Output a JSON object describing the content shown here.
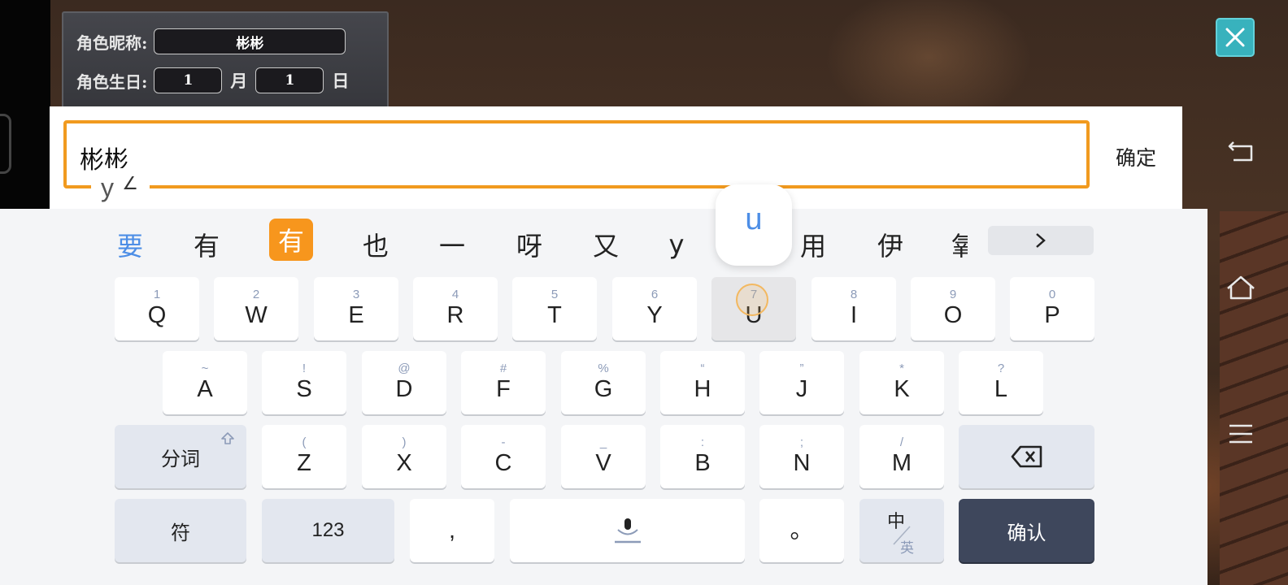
{
  "character_panel": {
    "nickname_label": "角色昵称:",
    "nickname_value": "彬彬",
    "birthday_label": "角色生日:",
    "month_value": "1",
    "month_unit": "月",
    "day_value": "1",
    "day_unit": "日"
  },
  "input": {
    "value": "彬彬",
    "confirm_label": "确定",
    "composition": "y"
  },
  "keyboard": {
    "candidates": [
      "要",
      "有",
      "有",
      "也",
      "一",
      "呀",
      "又",
      "y",
      "用",
      "伊",
      "氧"
    ],
    "popup_letter": "u",
    "row1": [
      {
        "sub": "1",
        "main": "Q"
      },
      {
        "sub": "2",
        "main": "W"
      },
      {
        "sub": "3",
        "main": "E"
      },
      {
        "sub": "4",
        "main": "R"
      },
      {
        "sub": "5",
        "main": "T"
      },
      {
        "sub": "6",
        "main": "Y"
      },
      {
        "sub": "7",
        "main": "U"
      },
      {
        "sub": "8",
        "main": "I"
      },
      {
        "sub": "9",
        "main": "O"
      },
      {
        "sub": "0",
        "main": "P"
      }
    ],
    "row2": [
      {
        "sub": "~",
        "main": "A"
      },
      {
        "sub": "!",
        "main": "S"
      },
      {
        "sub": "@",
        "main": "D"
      },
      {
        "sub": "#",
        "main": "F"
      },
      {
        "sub": "%",
        "main": "G"
      },
      {
        "sub": "“",
        "main": "H"
      },
      {
        "sub": "”",
        "main": "J"
      },
      {
        "sub": "*",
        "main": "K"
      },
      {
        "sub": "?",
        "main": "L"
      }
    ],
    "row3": [
      {
        "sub": "(",
        "main": "Z"
      },
      {
        "sub": ")",
        "main": "X"
      },
      {
        "sub": "-",
        "main": "C"
      },
      {
        "sub": "_",
        "main": "V"
      },
      {
        "sub": ":",
        "main": "B"
      },
      {
        "sub": ";",
        "main": "N"
      },
      {
        "sub": "/",
        "main": "M"
      }
    ],
    "segment_label": "分词",
    "symbol_label": "符",
    "num_label": "123",
    "comma_label": ",",
    "period_label": "。",
    "lang_zh": "中",
    "lang_en": "英",
    "enter_label": "确认",
    "accent_color": "#f7961d",
    "enter_color": "#3e475c"
  },
  "icons": {
    "close": "close-icon",
    "back": "back-icon",
    "home": "home-icon",
    "menu": "menu-icon",
    "shift": "shift-icon",
    "backspace": "backspace-icon",
    "mic": "microphone-icon",
    "more": "chevron-right-icon"
  }
}
